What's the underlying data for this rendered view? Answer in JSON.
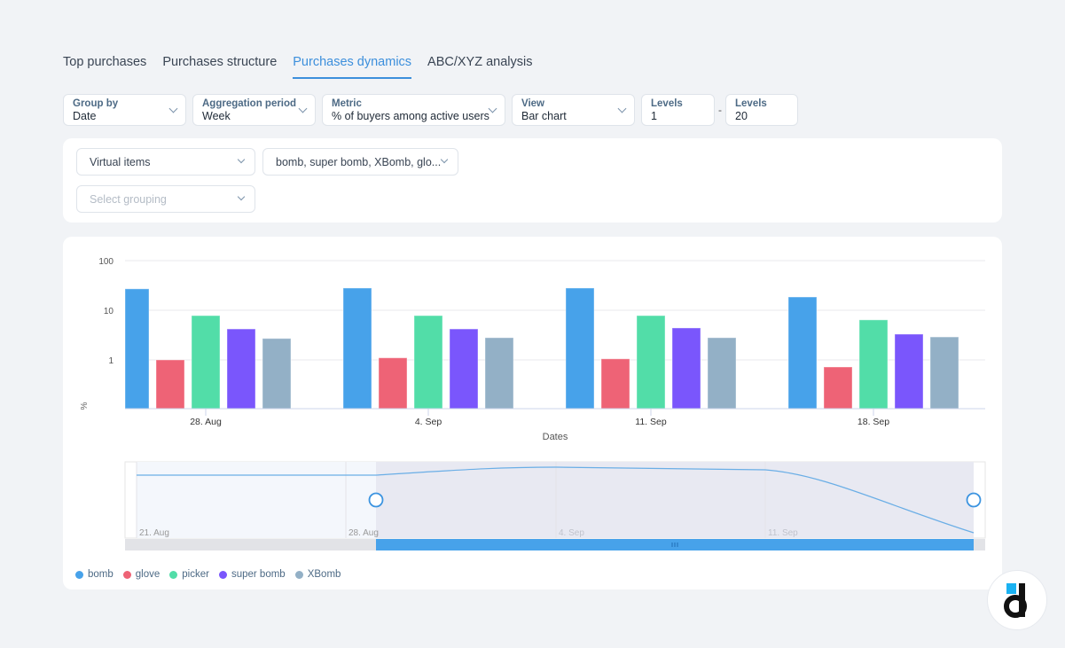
{
  "tabs": [
    {
      "label": "Top purchases",
      "active": false
    },
    {
      "label": "Purchases structure",
      "active": false
    },
    {
      "label": "Purchases dynamics",
      "active": true
    },
    {
      "label": "ABC/XYZ analysis",
      "active": false
    }
  ],
  "filters": {
    "group_by": {
      "label": "Group by",
      "value": "Date"
    },
    "aggregation": {
      "label": "Aggregation period",
      "value": "Week"
    },
    "metric": {
      "label": "Metric",
      "value": "% of buyers among active users"
    },
    "view": {
      "label": "View",
      "value": "Bar chart"
    },
    "levels_from": {
      "label": "Levels",
      "value": "1"
    },
    "levels_separator": "-",
    "levels_to": {
      "label": "Levels",
      "value": "20"
    }
  },
  "segment": {
    "item_type": "Virtual items",
    "items": "bomb, super bomb, XBomb, glo...",
    "grouping_placeholder": "Select grouping"
  },
  "chart_data": {
    "type": "bar",
    "yscale": "log",
    "categories": [
      "28. Aug",
      "4. Sep",
      "11. Sep",
      "18. Sep"
    ],
    "series": [
      {
        "name": "bomb",
        "color": "#47a2ea",
        "values": [
          27,
          28,
          28,
          18.5
        ]
      },
      {
        "name": "glove",
        "color": "#ee6376",
        "values": [
          1.0,
          1.1,
          1.05,
          0.72
        ]
      },
      {
        "name": "picker",
        "color": "#52dda8",
        "values": [
          7.8,
          7.8,
          7.8,
          6.4
        ]
      },
      {
        "name": "super bomb",
        "color": "#7a56fc",
        "values": [
          4.2,
          4.2,
          4.4,
          3.3
        ]
      },
      {
        "name": "XBomb",
        "color": "#93b0c6",
        "values": [
          2.7,
          2.8,
          2.8,
          2.9
        ]
      }
    ],
    "yticks": [
      "1",
      "10",
      "100"
    ],
    "ylim": [
      0.1,
      100
    ],
    "xlabel": "Dates",
    "ylabel": "%",
    "grid": true,
    "legend": "bottom-left",
    "navigator": {
      "labels": [
        "21. Aug",
        "28. Aug",
        "4. Sep",
        "11. Sep"
      ],
      "selected_range": [
        "28. Aug",
        "18. Sep"
      ]
    }
  }
}
